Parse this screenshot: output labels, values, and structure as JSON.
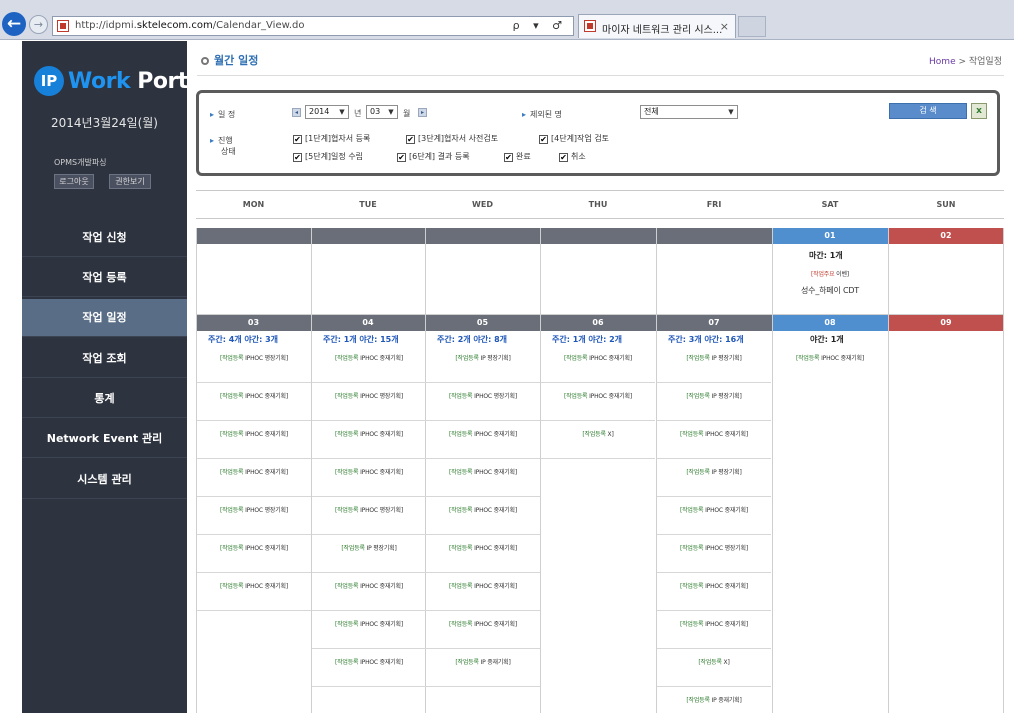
{
  "browser": {
    "url_prefix": "http://idpmi.",
    "url_domain": "sktelecom.com",
    "url_path": "/Calendar_View.do",
    "addr_icons": "ρ ▾ ♂",
    "tab_title": "마이자 네트워크 관리 시스...",
    "tab_close": "×",
    "back_glyph": "←",
    "forward_glyph": "→"
  },
  "sidebar": {
    "logo_ip": "IP",
    "logo_work": "Work",
    "logo_portal": "Portal",
    "date": "2014년3월24일(월)",
    "user": "OPMS개발파싱",
    "logout_label": "로그아웃",
    "perm_label": "권한보기",
    "nav": [
      {
        "label": "작업 신청",
        "active": false
      },
      {
        "label": "작업 등록",
        "active": false
      },
      {
        "label": "작업 일정",
        "active": true
      },
      {
        "label": "작업 조회",
        "active": false
      },
      {
        "label": "통계",
        "active": false
      },
      {
        "label": "Network Event 관리",
        "active": false
      },
      {
        "label": "시스템 관리",
        "active": false
      }
    ]
  },
  "header": {
    "title": "월간 일정",
    "crumb_home": "Home",
    "crumb_sep": " > ",
    "crumb_current": "작업일정"
  },
  "filter": {
    "period_label": "일 정",
    "year": "2014",
    "year_unit": "년",
    "month": "03",
    "month_unit": "월",
    "prev_glyph": "◂",
    "next_glyph": "▸",
    "network_label": "제외된 명",
    "network_value": "전체",
    "status_label_1": "진행",
    "status_label_2": "상태",
    "search_label": "검 색",
    "excel_label": "x",
    "checks": [
      {
        "label": "[1단계]협자서 등록",
        "checked": true
      },
      {
        "label": "[3단계]협자서 사전검토",
        "checked": true
      },
      {
        "label": "[4단계]작업 검토",
        "checked": true
      },
      {
        "label": "[5단계]일정 수립",
        "checked": true
      },
      {
        "label": "[6단계] 결과 등록",
        "checked": true
      },
      {
        "label": "완료",
        "checked": true
      },
      {
        "label": "취소",
        "checked": true
      }
    ],
    "check_mark": "✔"
  },
  "weekdays": [
    "MON",
    "TUE",
    "WED",
    "THU",
    "FRI",
    "SAT",
    "SUN"
  ],
  "calendar": {
    "week1": {
      "days": [
        "",
        "",
        "",
        "",
        "",
        "01",
        "02"
      ],
      "sat_count": "마간: 1개",
      "sat_event_l1_type": "[작업주요",
      "sat_event_l1_rest": " 이벤]",
      "sat_event_l2": "성수_하페이 CDT"
    },
    "week2": {
      "days": [
        "03",
        "04",
        "05",
        "06",
        "07",
        "08",
        "09"
      ],
      "counts": [
        {
          "a": "주간: 4개",
          "b": "야간: 3개"
        },
        {
          "a": "주간: 1개",
          "b": "야간: 15개"
        },
        {
          "a": "주간: 2개",
          "b": "야간: 8개"
        },
        {
          "a": "주간: 1개",
          "b": "야간: 2개"
        },
        {
          "a": "주간: 3개",
          "b": "야간: 16개"
        },
        {
          "a": "",
          "b": "야간: 1개"
        }
      ],
      "columns": [
        [
          {
            "g": "[작업등록",
            "r": " IPHOC 평장기획]",
            "tag": "",
            "t": "부엉국사 LTE_E",
            "style": ""
          },
          {
            "g": "[작업등록",
            "r": " IPHOC 중재기획]",
            "tag": "B",
            "t": "태평_eNB5/W_",
            "style": ""
          },
          {
            "g": "[작업등록",
            "r": " IPHOC 중재기획]",
            "tag": "B",
            "t": "성수 T서비스존 L",
            "style": ""
          },
          {
            "g": "[작업등록",
            "r": " IPHOC 중재기획]",
            "tag": "B",
            "t": "분당 SKP 서버",
            "style": ""
          },
          {
            "g": "[작업등록",
            "r": " IPHOC 평장기획]",
            "tag": "R",
            "t": "부엉국사 LTE_E",
            "style": "pink"
          },
          {
            "g": "[작업등록",
            "r": " IPHOC 중재기획]",
            "tag": "R",
            "t": "산합국사 LTE_E",
            "style": "pink"
          },
          {
            "g": "[작업등록",
            "r": " IPHOC 중재기획]",
            "tag": "B",
            "t": "[산합] VLAN",
            "style": ""
          }
        ],
        [
          {
            "g": "[작업등록",
            "r": " IPHOC 중재기획]",
            "tag": "",
            "t": "[성수] IMS_S",
            "style": ""
          },
          {
            "g": "[작업등록",
            "r": " IPHOC 평장기획]",
            "tag": "",
            "t": "성수_LTE_극한건",
            "style": ""
          },
          {
            "g": "[작업등록",
            "r": " IPHOC 중재기획]",
            "tag": "",
            "t": "[보라매] PE#1",
            "style": ""
          },
          {
            "g": "[작업등록",
            "r": " IPHOC 중재기획]",
            "tag": "",
            "t": "둔산DOSN#201",
            "style": ""
          },
          {
            "g": "[작업등록",
            "r": " IPHOC 평장기획]",
            "tag": "",
            "t": "성수_LTE NAT",
            "style": ""
          },
          {
            "g": "[작업등록",
            "r": " IP 평장기획]",
            "tag": "R",
            "t": "둔산_SG_SBG",
            "style": "pink"
          },
          {
            "g": "[작업등록",
            "r": " IPHOC 중재기획]",
            "tag": "",
            "t": "보라매_ATM#2_",
            "style": ""
          },
          {
            "g": "[작업등록",
            "r": " IPHOC 중재기획]",
            "tag": "",
            "t": "[성수/둔산] IP",
            "style": ""
          },
          {
            "g": "[작업등록",
            "r": " IPHOC 중재기획]",
            "tag": "",
            "t": "[대전] SGW#5",
            "style": ""
          }
        ],
        [
          {
            "g": "[작업등록",
            "r": " IP 평장기획]",
            "tag": "",
            "t": "전략 LTE_ENB",
            "style": ""
          },
          {
            "g": "[작업등록",
            "r": " IPHOC 평장기획]",
            "tag": "",
            "t": "광주국사 LTE_S",
            "style": ""
          },
          {
            "g": "[작업등록",
            "r": " IPHOC 중재기획]",
            "tag": "R",
            "t": "[수원] eNode",
            "style": "pink"
          },
          {
            "g": "[작업등록",
            "r": " IPHOC 중재기획]",
            "tag": "",
            "t": "[수원]_LTE_전",
            "style": ""
          },
          {
            "g": "[작업등록",
            "r": " IPHOC 중재기획]",
            "tag": "",
            "t": "[보라매] ENB",
            "style": ""
          },
          {
            "g": "[작업등록",
            "r": " IPHOC 중재기획]",
            "tag": "R",
            "t": "분당_H내 스위치",
            "style": "pink"
          },
          {
            "g": "[작업등록",
            "r": " IPHOC 중재기획]",
            "tag": "R",
            "t": "[성수D] PDW#",
            "style": "pink"
          },
          {
            "g": "[작업등록",
            "r": " IPHOC 중재기획]",
            "tag": "B",
            "t": "분당_H서비스_HS",
            "style": ""
          },
          {
            "g": "[작업등록",
            "r": " IP 중재기획]",
            "tag": "R",
            "t": "성수국사 S1 스위",
            "style": "pink"
          }
        ],
        [
          {
            "g": "[작업등록",
            "r": " IPHOC 중재기획]",
            "tag": "R",
            "t": "성수_IMS_LAS",
            "style": "pink"
          },
          {
            "g": "[작업등록",
            "r": " IPHOC 중재기획]",
            "tag": "B",
            "t": "성수_IMS LAS",
            "style": ""
          },
          {
            "g": "[작업등록",
            "r": " X]",
            "tag": "R",
            "t": "둔산_ACSM협_G",
            "style": "pink"
          }
        ],
        [
          {
            "g": "[작업등록",
            "r": " IP 평장기획]",
            "tag": "R",
            "t": "[성수/둔산] 장소",
            "style": "pink"
          },
          {
            "g": "[작업등록",
            "r": " IP 평장기획]",
            "tag": "",
            "t": "둔산_LTE_극한건",
            "style": ""
          },
          {
            "g": "[작업등록",
            "r": " IPHOC 중재기획]",
            "tag": "",
            "t": "둔산_VOMS 교도",
            "style": ""
          },
          {
            "g": "[작업등록",
            "r": " IP 평장기획]",
            "tag": "",
            "t": "둔산 DOSN#20",
            "style": ""
          },
          {
            "g": "[작업등록",
            "r": " IPHOC 중재기획]",
            "tag": "",
            "t": "[광주,전주,동주]",
            "style": ""
          },
          {
            "g": "[작업등록",
            "r": " IPHOC 평장기획]",
            "tag": "",
            "t": "[성수] ACSM_",
            "style": ""
          },
          {
            "g": "[작업등록",
            "r": " IPHOC 중재기획]",
            "tag": "R",
            "t": "부사_MPLS_Co",
            "style": "pink"
          },
          {
            "g": "[작업등록",
            "r": " IPHOC 중재기획]",
            "tag": "",
            "t": "전주_MPLS_P#",
            "style": ""
          },
          {
            "g": "[작업등록",
            "r": " X]",
            "tag": "R",
            "t": "[분당] eNB V",
            "style": "pink"
          },
          {
            "g": "[작업등록",
            "r": " IP 중재기획]",
            "tag": "",
            "t": "",
            "style": ""
          }
        ],
        [
          {
            "g": "[작업등록",
            "r": " IPHOC 중재기획]",
            "tag": "",
            "t": "성수_하페이 CDT",
            "style": ""
          }
        ]
      ]
    },
    "tag_b_label": "B2",
    "tag_r_label": "K3"
  },
  "colors": {
    "sidebar_bg": "#2d333f",
    "nav_active": "#5a6d86",
    "sat_header": "#4f8fd0",
    "sun_header": "#c0504d",
    "weekday_header": "#6a6e78",
    "count_blue": "#1f57b8",
    "highlight_pink": "#f4b6b6"
  }
}
